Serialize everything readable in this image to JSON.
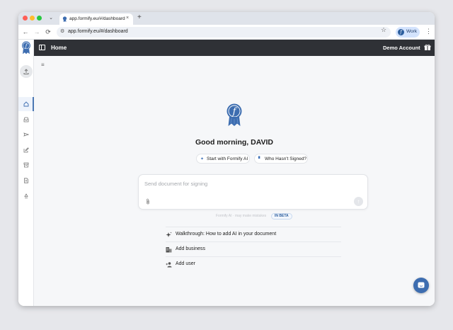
{
  "browser": {
    "tab_title": "app.formify.eu/#/dashboard",
    "tab_close": "×",
    "new_tab": "+",
    "url": "app.formify.eu/#/dashboard",
    "profile_label": "Work",
    "profile_initial": "f",
    "nav_back": "←",
    "nav_forward": "→",
    "nav_reload": "⟳",
    "star": "☆",
    "menu": "⋮",
    "tab_search": "⌄",
    "site_info": "⚙"
  },
  "appbar": {
    "title": "Home",
    "account": "Demo Account"
  },
  "sidebar": {
    "items": [
      {
        "name": "home",
        "icon": "home-icon",
        "active": true
      },
      {
        "name": "inbox",
        "icon": "inbox-icon"
      },
      {
        "name": "sent",
        "icon": "send-icon"
      },
      {
        "name": "drafts",
        "icon": "edit-icon"
      },
      {
        "name": "archive",
        "icon": "archive-icon"
      },
      {
        "name": "templates",
        "icon": "document-icon"
      },
      {
        "name": "recycle",
        "icon": "recycle-icon"
      }
    ]
  },
  "main": {
    "menu_glyph": "≡",
    "greeting": "Good morning, DAVID",
    "chips": [
      {
        "label": "Start with Formify AI",
        "glyph": "✦"
      },
      {
        "label": "Who Hasn't Signed?",
        "glyph": "▘"
      }
    ],
    "composer": {
      "placeholder": "Send document for signing",
      "send_glyph": "↑"
    },
    "powered_by": "Formify AI · may make mistakes",
    "beta_badge": "IN BETA",
    "actions": [
      {
        "label": "Walkthrough: How to add AI in your document",
        "icon": "sparkle-icon"
      },
      {
        "label": "Add business",
        "icon": "business-icon"
      },
      {
        "label": "Add user",
        "icon": "add-user-icon"
      }
    ]
  },
  "colors": {
    "brand": "#3d6db0",
    "appbar": "#2f3136",
    "background": "#f6f7f9"
  }
}
